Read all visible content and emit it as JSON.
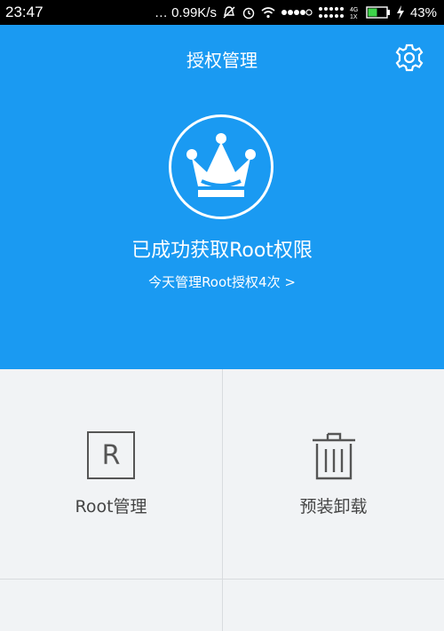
{
  "status_bar": {
    "time": "23:47",
    "speed": "… 0.99K/s",
    "network": "4G\n1X",
    "battery": "43%"
  },
  "header": {
    "title": "授权管理",
    "settings_icon": "gear-icon"
  },
  "hero": {
    "icon": "crown-icon",
    "status_text": "已成功获取Root权限",
    "manage_link": "今天管理Root授权4次 >"
  },
  "tiles": [
    {
      "label": "Root管理",
      "icon_glyph": "R",
      "icon": "root-box-icon"
    },
    {
      "label": "预装卸载",
      "icon": "trash-icon"
    }
  ],
  "colors": {
    "accent": "#1a9af2",
    "background": "#f1f3f5",
    "text": "#444444"
  }
}
